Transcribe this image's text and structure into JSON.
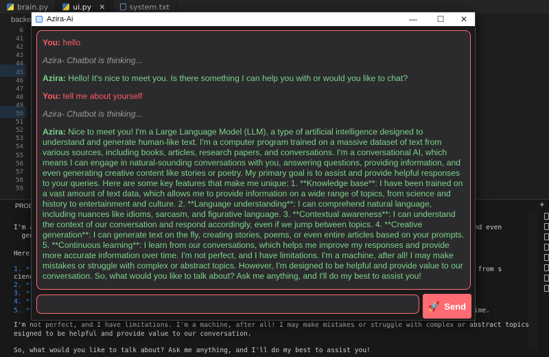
{
  "editor": {
    "tabs": [
      {
        "label": "brain.py",
        "icon": "python-file-icon"
      },
      {
        "label": "ui.py",
        "icon": "python-file-icon"
      },
      {
        "label": "system.txt",
        "icon": "text-file-icon"
      }
    ],
    "breadcrumb": "backen",
    "line_numbers": [
      "6",
      "41",
      "42",
      "43",
      "44",
      "45",
      "46",
      "47",
      "48",
      "49",
      "50",
      "51",
      "52",
      "53",
      "54",
      "55",
      "56",
      "57",
      "58",
      "59"
    ],
    "panel_title": "PROBLE",
    "terminal_lines": [
      "I'm a",
      "  gene",
      "Here",
      "1. **",
      "ciend",
      "2. **",
      "3. **",
      "4. **",
      "5. **",
      "I'm not perfect, and I have limitations. I'm a machine, after all! I may make mistakes or struggle with complex or abstract topics. However, I'm d",
      "esigned to be helpful and provide value to our conversation.",
      "So, what would you like to talk about? Ask me anything, and I'll do my best to assist you!"
    ],
    "terminal_right": [
      "and even",
      ", from s",
      "time."
    ],
    "colors": {
      "accent": "#ff6b73",
      "user": "#ff5a64",
      "bot": "#7dd38b",
      "thinking": "#9a9a9a"
    }
  },
  "window": {
    "title": "Azira-Ai",
    "minimize": "—",
    "maximize": "☐",
    "close": "✕"
  },
  "chat": {
    "messages": [
      {
        "kind": "user",
        "speaker": "You:",
        "text": " hello"
      },
      {
        "kind": "thinking",
        "speaker": "",
        "text": "Azira- Chatbot is thinking..."
      },
      {
        "kind": "bot",
        "speaker": "Azira:",
        "text": " Hello! It's nice to meet you. Is there something I can help you with or would you like to chat?"
      },
      {
        "kind": "user",
        "speaker": "You:",
        "text": " tell me about yourself"
      },
      {
        "kind": "thinking",
        "speaker": "",
        "text": "Azira- Chatbot is thinking..."
      },
      {
        "kind": "bot",
        "speaker": "Azira:",
        "text": " Nice to meet you! I'm a Large Language Model (LLM), a type of artificial intelligence designed to understand and generate human-like text. I'm a computer program trained on a massive dataset of text from various sources, including books, articles, research papers, and conversations. I'm a conversational AI, which means I can engage in natural-sounding conversations with you, answering questions, providing information, and even generating creative content like stories or poetry. My primary goal is to assist and provide helpful responses to your queries. Here are some key features that make me unique: 1. **Knowledge base**: I have been trained on a vast amount of text data, which allows me to provide information on a wide range of topics, from science and history to entertainment and culture. 2. **Language understanding**: I can comprehend natural language, including nuances like idioms, sarcasm, and figurative language. 3. **Contextual awareness**: I can understand the context of our conversation and respond accordingly, even if we jump between topics. 4. **Creative generation**: I can generate text on the fly, creating stories, poems, or even entire articles based on your prompts. 5. **Continuous learning**: I learn from our conversations, which helps me improve my responses and provide more accurate information over time. I'm not perfect, and I have limitations. I'm a machine, after all! I may make mistakes or struggle with complex or abstract topics. However, I'm designed to be helpful and provide value to our conversation. So, what would you like to talk about? Ask me anything, and I'll do my best to assist you!"
      }
    ],
    "input_value": "",
    "send_label": "Send",
    "send_icon": "rocket-icon"
  }
}
